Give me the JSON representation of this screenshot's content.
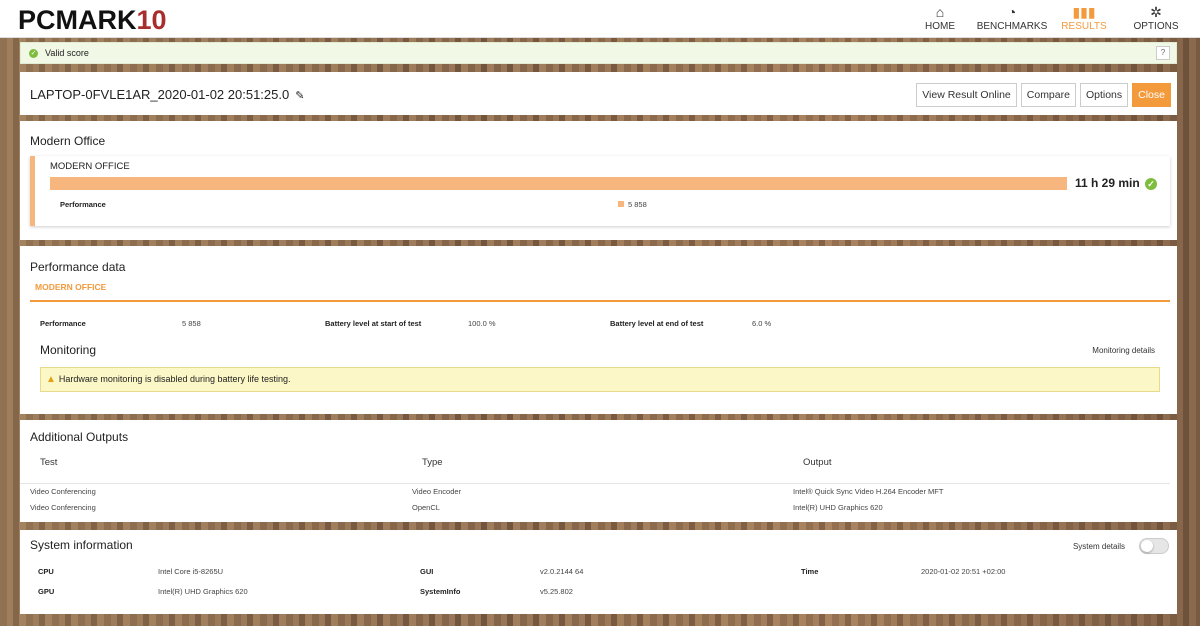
{
  "app": {
    "logo_main": "PCMARK",
    "logo_num": "10"
  },
  "nav": [
    {
      "label": "HOME",
      "icon": "home-icon"
    },
    {
      "label": "BENCHMARKS",
      "icon": "gauge-icon"
    },
    {
      "label": "RESULTS",
      "icon": "bar-chart-icon",
      "active": true
    },
    {
      "label": "OPTIONS",
      "icon": "gear-icon"
    }
  ],
  "valid_banner": {
    "text": "Valid score",
    "help": "?"
  },
  "result": {
    "name": "LAPTOP-0FVLE1AR_2020-01-02 20:51:25.0"
  },
  "header_buttons": {
    "view_online": "View Result Online",
    "compare": "Compare",
    "options": "Options",
    "close": "Close"
  },
  "modern_office": {
    "section_title": "Modern Office",
    "card_title": "MODERN OFFICE",
    "score": "11 h 29 min",
    "performance_label": "Performance",
    "performance_value": "5 858"
  },
  "performance_data": {
    "section_title": "Performance data",
    "tab": "MODERN OFFICE",
    "rows": [
      {
        "label": "Performance",
        "value": "5 858"
      },
      {
        "label": "Battery level at start of test",
        "value": "100.0 %"
      },
      {
        "label": "Battery level at end of test",
        "value": "6.0 %"
      }
    ],
    "monitoring_title": "Monitoring",
    "monitoring_details": "Monitoring details",
    "warning": "Hardware monitoring is disabled during battery life testing."
  },
  "additional_outputs": {
    "section_title": "Additional Outputs",
    "headers": [
      "Test",
      "Type",
      "Output"
    ],
    "rows": [
      [
        "Video Conferencing",
        "Video Encoder",
        "Intel® Quick Sync Video H.264 Encoder MFT"
      ],
      [
        "Video Conferencing",
        "OpenCL",
        "Intel(R) UHD Graphics 620"
      ]
    ]
  },
  "system_info": {
    "section_title": "System information",
    "details_label": "System details",
    "cpu_label": "CPU",
    "cpu_value": "Intel Core i5-8265U",
    "gpu_label": "GPU",
    "gpu_value": "Intel(R) UHD Graphics 620",
    "gui_label": "GUI",
    "gui_value": "v2.0.2144 64",
    "sysinfo_label": "SystemInfo",
    "sysinfo_value": "v5.25.802",
    "time_label": "Time",
    "time_value": "2020-01-02 20:51 +02:00"
  },
  "colors": {
    "accent": "#f39a3d",
    "bar": "#f7b67e",
    "ok": "#7ebd3e",
    "logo_ten": "#a82d2d"
  }
}
